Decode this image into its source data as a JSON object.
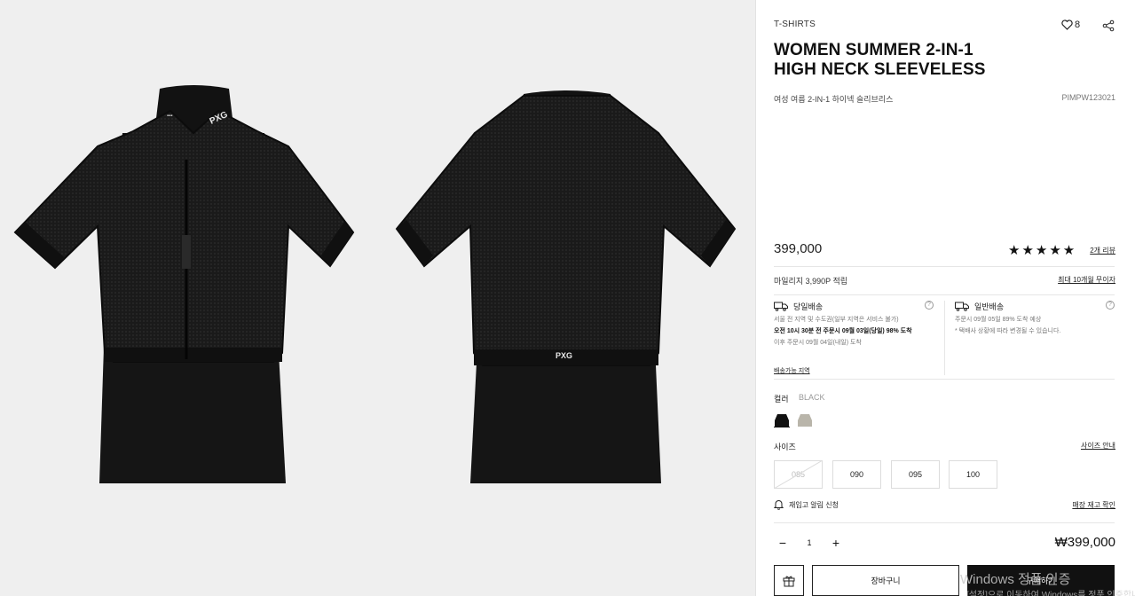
{
  "gallery": {
    "front_logo_text": "PXG",
    "back_logo_text": "PXG"
  },
  "product": {
    "category": "T-SHIRTS",
    "wishlist_count": "8",
    "title_line1": "WOMEN SUMMER 2-IN-1",
    "title_line2": "HIGH NECK SLEEVELESS",
    "subtitle": "여성 여름 2-IN-1 하이넥 슬리브리스",
    "sku": "PIMPW123021",
    "price": "399,000",
    "rating": "★★★★★",
    "reviews_link": "2개 리뷰"
  },
  "mileage": {
    "text": "마일리지 3,990P 적립",
    "coupon_link": "최대 10개월 무이자"
  },
  "shipping": {
    "same_day": {
      "title": "당일배송",
      "line1": "서울 전 지역 및 수도권(일부 지역은 서비스 불가)",
      "line2": "오전 10시 30분 전 주문시 09월 03일(당일) 98% 도착",
      "line3": "이후 주문시 09월 04일(내일) 도착",
      "area_link": "배송가능 지역"
    },
    "standard": {
      "title": "일반배송",
      "line1": "주문시 09월 05일 89% 도착 예상",
      "line2": "* 택배사 상황에 따라 변경될 수 있습니다."
    }
  },
  "color": {
    "label": "컬러",
    "selected": "BLACK",
    "swatches": [
      {
        "name": "black",
        "hex": "#111111"
      },
      {
        "name": "beige",
        "hex": "#b9b5aa"
      }
    ]
  },
  "size": {
    "label": "사이즈",
    "guide_link": "사이즈 안내",
    "options": [
      {
        "label": "085",
        "sold_out": true
      },
      {
        "label": "090",
        "sold_out": false
      },
      {
        "label": "095",
        "sold_out": false
      },
      {
        "label": "100",
        "sold_out": false
      }
    ]
  },
  "restock": {
    "label": "재입고 알림 신청",
    "stock_link": "매장 재고 확인"
  },
  "quantity": {
    "minus": "−",
    "value": "1",
    "plus": "+",
    "total": "₩399,000"
  },
  "actions": {
    "cart": "장바구니",
    "buy": "구매하기"
  },
  "overlay": {
    "watermark_line1": "Windows 정품 인증",
    "watermark_line2": "[설정]으로 이동하여 Windows를 정품 인증합니다."
  }
}
